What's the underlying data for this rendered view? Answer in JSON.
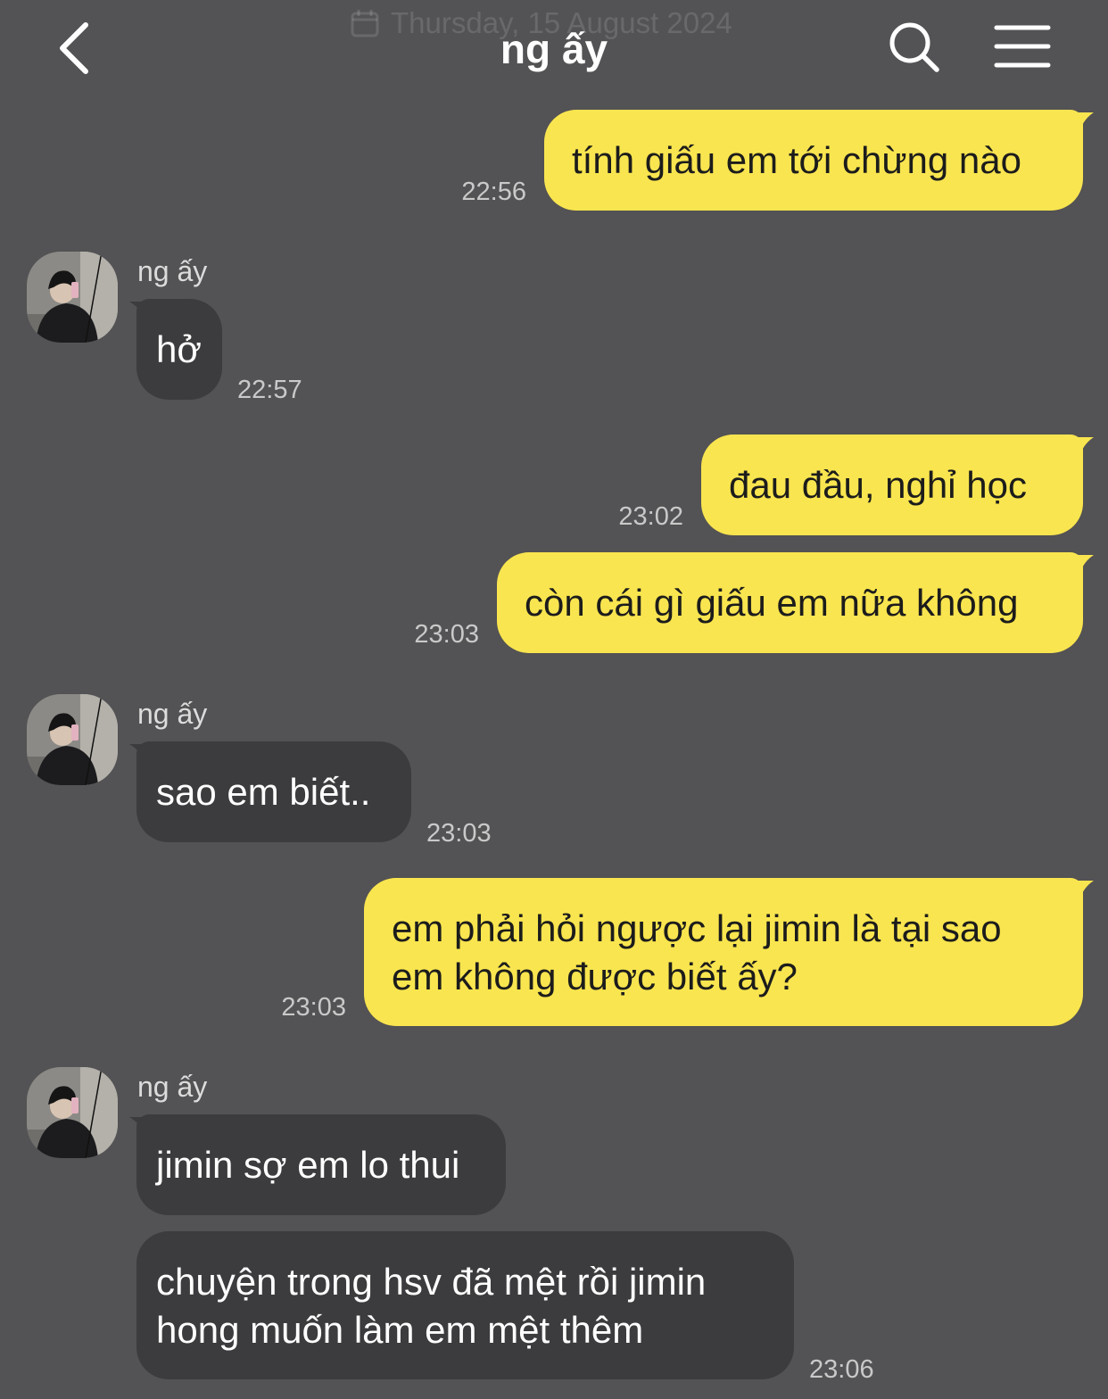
{
  "header": {
    "title": "ng ấy",
    "date_overlay": "Thursday, 15 August 2024"
  },
  "messages": [
    {
      "dir": "out",
      "text": "tính giấu em tới chừng nào",
      "time": "22:56"
    },
    {
      "dir": "in",
      "sender": "ng ấy",
      "text": "hở",
      "time": "22:57"
    },
    {
      "dir": "out",
      "text": "đau đầu, nghỉ học",
      "time": "23:02"
    },
    {
      "dir": "out",
      "text": "còn cái gì giấu em nữa không",
      "time": "23:03"
    },
    {
      "dir": "in",
      "sender": "ng ấy",
      "text": "sao em biết..",
      "time": "23:03"
    },
    {
      "dir": "out",
      "lines": [
        "em phải hỏi ngược lại jimin là tại sao",
        "em không được biết ấy?"
      ],
      "time": "23:03"
    },
    {
      "dir": "in",
      "sender": "ng ấy",
      "text": "jimin sợ em lo thui"
    },
    {
      "dir": "in",
      "lines": [
        "chuyện trong hsv đã mệt rồi jimin",
        "hong muốn làm em mệt thêm"
      ],
      "time": "23:06"
    }
  ],
  "colors": {
    "background": "#535254",
    "outgoing_bubble": "#f9e54f",
    "incoming_bubble": "#3c3b3d"
  },
  "icons": [
    "back-arrow-icon",
    "calendar-icon",
    "search-icon",
    "hamburger-menu-icon"
  ]
}
